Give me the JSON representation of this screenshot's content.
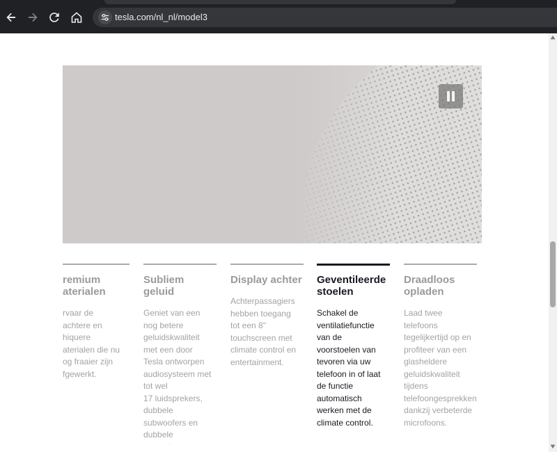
{
  "browser": {
    "url": "tesla.com/nl_nl/model3",
    "back_icon": "arrow-left-icon",
    "forward_icon": "arrow-right-icon",
    "reload_icon": "reload-icon",
    "home_icon": "home-icon",
    "site_info_icon": "tune-icon"
  },
  "media": {
    "pause_icon": "pause-icon"
  },
  "features": [
    {
      "title": "remium\naterialen",
      "desc": "rvaar de\nachtere en\nhiquere\naterialen die nu\nog fraaier zijn\nfgewerkt.",
      "active": false
    },
    {
      "title": "Subliem geluid",
      "desc": "Geniet van een\nnog betere\ngeluidskwaliteit\nmet een door\nTesla ontworpen\naudiosysteem met\ntot wel\n17 luidsprekers,\ndubbele\nsubwoofers en\ndubbele\nversterkers.",
      "active": false
    },
    {
      "title": "Display achter",
      "desc": "Achterpassagiers\nhebben toegang\ntot een 8\"\ntouchscreen met\nclimate control en\nentertainment.",
      "active": false
    },
    {
      "title": "Geventileerde\nstoelen",
      "desc": "Schakel de\nventilatiefunctie\nvan de\nvoorstoelen van\ntevoren via uw\ntelefoon in of laat\nde functie\nautomatisch\nwerken met de\nclimate control.",
      "active": true
    },
    {
      "title": "Draadloos\nopladen",
      "desc": "Laad twee\ntelefoons\ntegelijkertijd op en\nprofiteer van een\nglasheldere\ngeluidskwaliteit\ntijdens\ntelefoongesprekken\ndankzij verbeterde\nmicrofoons.",
      "active": false
    }
  ],
  "colors": {
    "chrome_bg": "#202124",
    "omnibox_bg": "#35363a",
    "active_text": "#171a20",
    "inactive_text": "#9a9a9a"
  }
}
